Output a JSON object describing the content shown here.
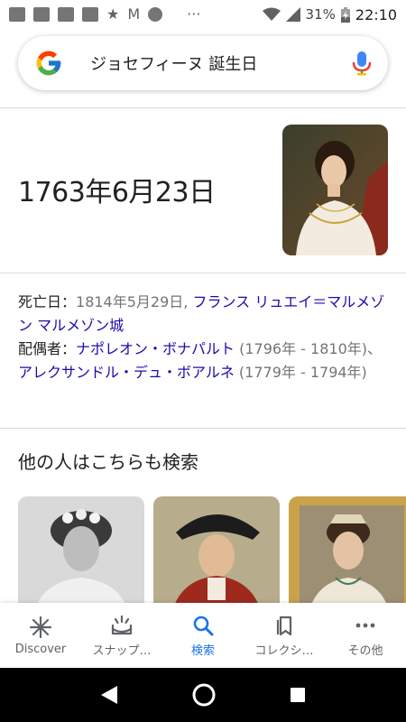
{
  "status_bar": {
    "battery": "31%",
    "time": "22:10"
  },
  "search": {
    "query": "ジョセフィーヌ 誕生日"
  },
  "answer": {
    "birth_date": "1763年6月23日"
  },
  "facts": {
    "death_label": "死亡日：",
    "death_date": "1814年5月29日, ",
    "death_place_link": "フランス リュエイ＝マルメゾン マルメゾン城",
    "spouse_label": "配偶者：",
    "spouse1_link": "ナポレオン・ボナパルト",
    "spouse1_years": " (1796年 - 1810年)、",
    "spouse2_link": "アレクサンドル・デュ・ボアルネ",
    "spouse2_years": " (1779年 - 1794年)"
  },
  "related": {
    "title": "他の人はこちらも検索"
  },
  "bottom_nav": {
    "items": [
      {
        "label": "Discover",
        "icon": "asterisk-icon"
      },
      {
        "label": "スナップ…",
        "icon": "snapshot-icon"
      },
      {
        "label": "検索",
        "icon": "search-icon"
      },
      {
        "label": "コレクシ…",
        "icon": "bookmarks-icon"
      },
      {
        "label": "その他",
        "icon": "more-dots-icon"
      }
    ],
    "active_index": 2
  },
  "colors": {
    "link": "#1a0dab",
    "accent": "#1a73e8",
    "text": "#202124",
    "secondary": "#70757a"
  }
}
